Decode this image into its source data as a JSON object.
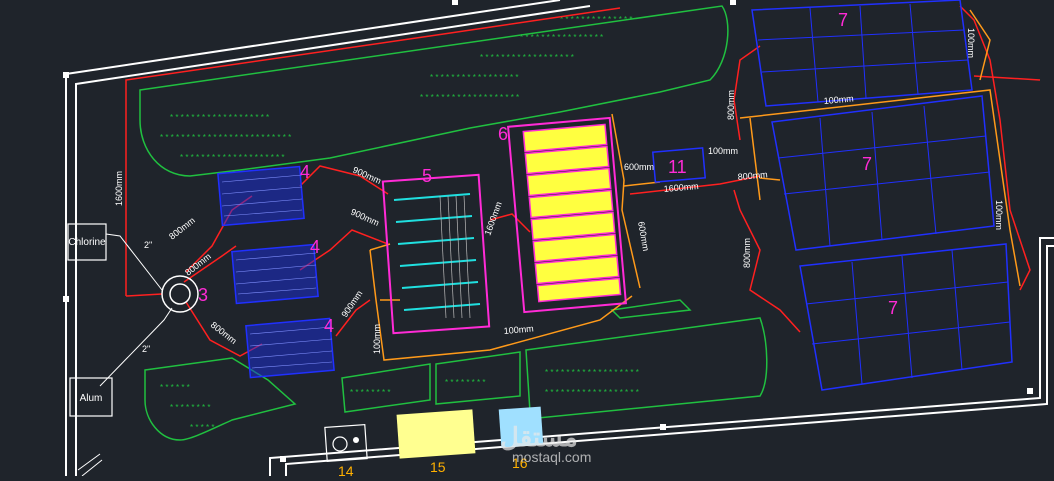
{
  "boxes": {
    "chlorine": "Chlorine",
    "alum": "Alum"
  },
  "labels": {
    "n3": "3",
    "n4a": "4",
    "n4b": "4",
    "n4c": "4",
    "n5": "5",
    "n6": "6",
    "n7a": "7",
    "n7b": "7",
    "n7c": "7",
    "n11": "11",
    "n14": "14",
    "n15": "15",
    "n16": "16"
  },
  "dims": {
    "d1600_left": "1600mm",
    "d800_a": "800mm",
    "d800_b": "800mm",
    "d800_c": "800mm",
    "d900_a": "900mm",
    "d900_b": "900mm",
    "d900_c": "900mm",
    "d1600_mid": "1600mm",
    "d100_bottom": "100mm",
    "d100_left": "100mm",
    "d600_a": "600mm",
    "d600_b": "600mm",
    "d100_a": "100mm",
    "d1600_b": "1600mm",
    "d800_r1": "800mm",
    "d800_r2": "800mm",
    "d800_r3": "800mm",
    "d100_r1": "100mm",
    "d100_r2": "100mm",
    "d100_r3": "100mm",
    "pipe2a": "2\"",
    "pipe2b": "2\""
  },
  "watermark": {
    "brand": "مستقل",
    "site": "mostaql.com"
  },
  "colors": {
    "background": "#1f242b",
    "boundary": "#ffffff",
    "green_area": "#20c040",
    "red_pipe": "#ff2020",
    "orange_pipe": "#ff9a1a",
    "blue_units": "#2030ff",
    "magenta": "#ff2bd6",
    "yellow_fill": "#ffff40",
    "cyan": "#20e0e0",
    "light_yellow": "#ffff90",
    "light_blue": "#a0e0ff"
  }
}
